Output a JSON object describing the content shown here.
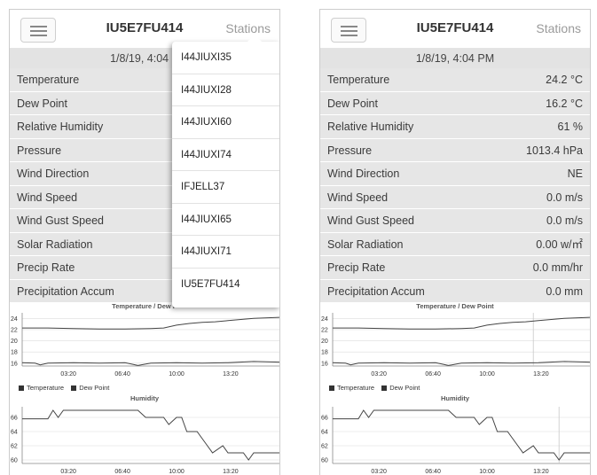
{
  "header": {
    "station": "IU5E7FU414",
    "stations_label": "Stations",
    "menu_icon": "hamburger-menu-icon"
  },
  "left_date": "1/8/19, 4:04 P",
  "date": "1/8/19, 4:04 PM",
  "readings": [
    {
      "label": "Temperature",
      "value": "24.2 °C"
    },
    {
      "label": "Dew Point",
      "value": "16.2 °C"
    },
    {
      "label": "Relative Humidity",
      "value": "61 %"
    },
    {
      "label": "Pressure",
      "value": "1013.4 hPa"
    },
    {
      "label": "Wind Direction",
      "value": "NE"
    },
    {
      "label": "Wind Speed",
      "value": "0.0 m/s"
    },
    {
      "label": "Wind Gust Speed",
      "value": "0.0 m/s"
    },
    {
      "label": "Solar Radiation",
      "value": "0.00 w/㎡"
    },
    {
      "label": "Precip Rate",
      "value": "0.0 mm/hr"
    },
    {
      "label": "Precipitation Accum",
      "value": "0.0 mm"
    }
  ],
  "stations_dropdown": [
    "I44JIUXI35",
    "I44JIUXI28",
    "I44JIUXI60",
    "I44JIUXI74",
    "IFJELL37",
    "I44JIUXI65",
    "I44JIUXI71",
    "IU5E7FU414"
  ],
  "chart_title_left": "Temperature / Dew P",
  "chart_data": [
    {
      "type": "line",
      "title": "Temperature / Dew Point",
      "x_ticks": [
        "03:20",
        "06:40",
        "10:00",
        "13:20"
      ],
      "y_ticks": [
        "24",
        "22",
        "20",
        "18",
        "16"
      ],
      "ylim": [
        15.5,
        25
      ],
      "legend": [
        "Temperature",
        "Dew Point"
      ],
      "series": [
        {
          "name": "Temperature",
          "points": [
            [
              0,
              22.3
            ],
            [
              0.1,
              22.3
            ],
            [
              0.2,
              22.2
            ],
            [
              0.3,
              22.1
            ],
            [
              0.4,
              22.1
            ],
            [
              0.5,
              22.2
            ],
            [
              0.55,
              22.3
            ],
            [
              0.6,
              22.8
            ],
            [
              0.65,
              23.1
            ],
            [
              0.7,
              23.3
            ],
            [
              0.75,
              23.4
            ],
            [
              0.8,
              23.6
            ],
            [
              0.9,
              24.0
            ],
            [
              1.0,
              24.2
            ]
          ]
        },
        {
          "name": "Dew Point",
          "points": [
            [
              0,
              16.1
            ],
            [
              0.05,
              16.0
            ],
            [
              0.07,
              15.7
            ],
            [
              0.1,
              16.0
            ],
            [
              0.2,
              16.1
            ],
            [
              0.3,
              16.0
            ],
            [
              0.4,
              16.1
            ],
            [
              0.45,
              15.6
            ],
            [
              0.5,
              16.0
            ],
            [
              0.6,
              16.1
            ],
            [
              0.7,
              16.0
            ],
            [
              0.8,
              16.1
            ],
            [
              0.9,
              16.3
            ],
            [
              1.0,
              16.2
            ]
          ]
        }
      ]
    },
    {
      "type": "line",
      "title": "Humidity",
      "x_ticks": [
        "03:20",
        "06:40",
        "10:00",
        "13:20"
      ],
      "y_ticks": [
        "66",
        "64",
        "62",
        "60"
      ],
      "ylim": [
        59.5,
        67.5
      ],
      "series": [
        {
          "name": "Humidity",
          "points": [
            [
              0,
              65.8
            ],
            [
              0.1,
              65.8
            ],
            [
              0.12,
              67.0
            ],
            [
              0.14,
              66.0
            ],
            [
              0.16,
              67.0
            ],
            [
              0.45,
              67.0
            ],
            [
              0.48,
              66.0
            ],
            [
              0.55,
              66.0
            ],
            [
              0.57,
              65.0
            ],
            [
              0.6,
              66.0
            ],
            [
              0.62,
              66.0
            ],
            [
              0.64,
              64.0
            ],
            [
              0.68,
              64.0
            ],
            [
              0.7,
              63.0
            ],
            [
              0.72,
              62.0
            ],
            [
              0.74,
              61.0
            ],
            [
              0.78,
              62.0
            ],
            [
              0.8,
              61.0
            ],
            [
              0.86,
              61.0
            ],
            [
              0.88,
              60.0
            ],
            [
              0.9,
              61.0
            ],
            [
              1.0,
              61.0
            ]
          ]
        }
      ]
    }
  ]
}
